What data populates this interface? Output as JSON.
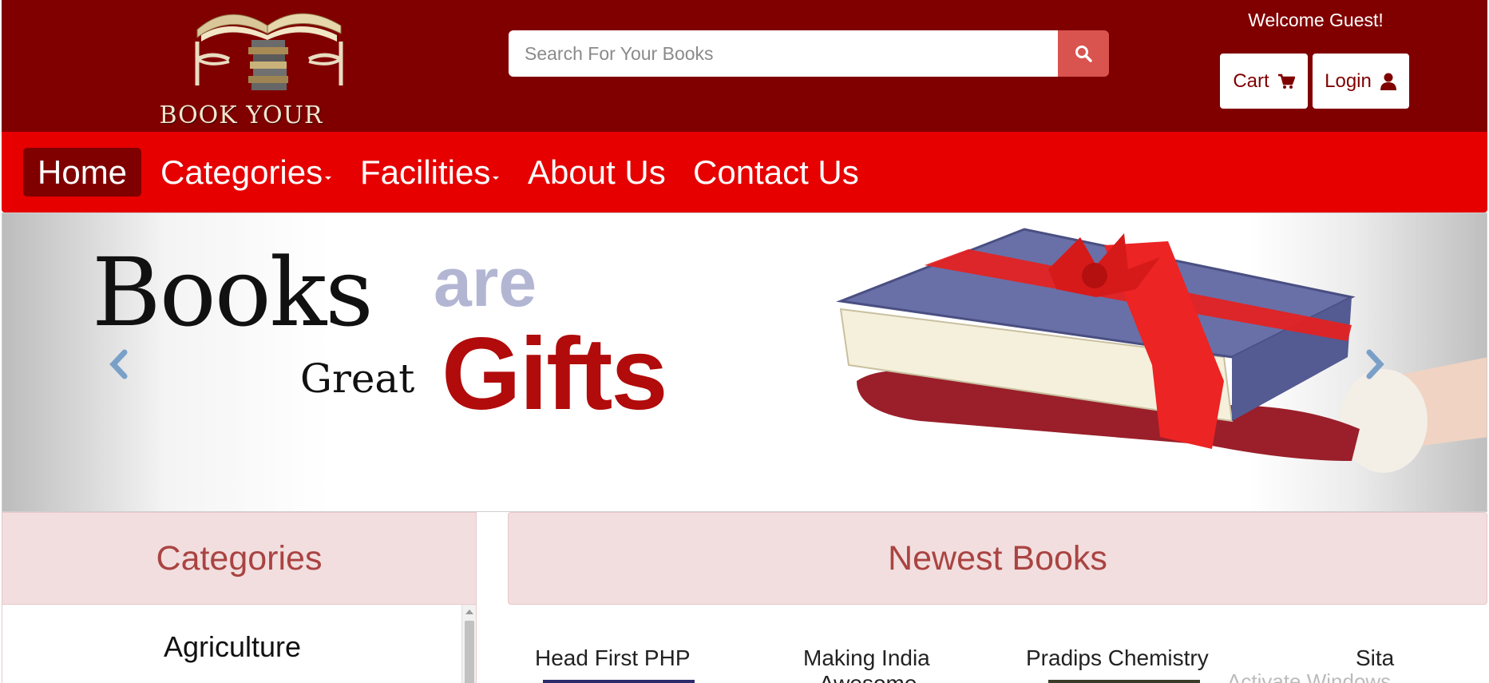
{
  "header": {
    "logo_text": "BOOK YOUR BOOKS",
    "search_placeholder": "Search For Your Books",
    "welcome": "Welcome Guest!",
    "cart_label": "Cart",
    "login_label": "Login"
  },
  "nav": {
    "items": [
      {
        "label": "Home",
        "active": true
      },
      {
        "label": "Categories",
        "dropdown": true
      },
      {
        "label": "Facilities",
        "dropdown": true
      },
      {
        "label": "About Us"
      },
      {
        "label": "Contact Us"
      }
    ]
  },
  "carousel": {
    "word_books": "Books",
    "word_are": "are",
    "word_great": "Great",
    "word_gifts": "Gifts"
  },
  "categories": {
    "title": "Categories",
    "items": [
      "Agriculture"
    ]
  },
  "newest": {
    "title": "Newest Books",
    "books": [
      {
        "title": "Head First PHP"
      },
      {
        "title": "Making India",
        "subtitle": "Awesome"
      },
      {
        "title": "Pradips Chemistry"
      },
      {
        "title": "Sita"
      }
    ]
  },
  "watermark": "Activate Windows",
  "colors": {
    "header_bg": "#800000",
    "nav_bg": "#e60000",
    "nav_active_bg": "#800000",
    "search_button": "#d9534f",
    "panel_bg": "#f2dede",
    "panel_text": "#a94442"
  }
}
